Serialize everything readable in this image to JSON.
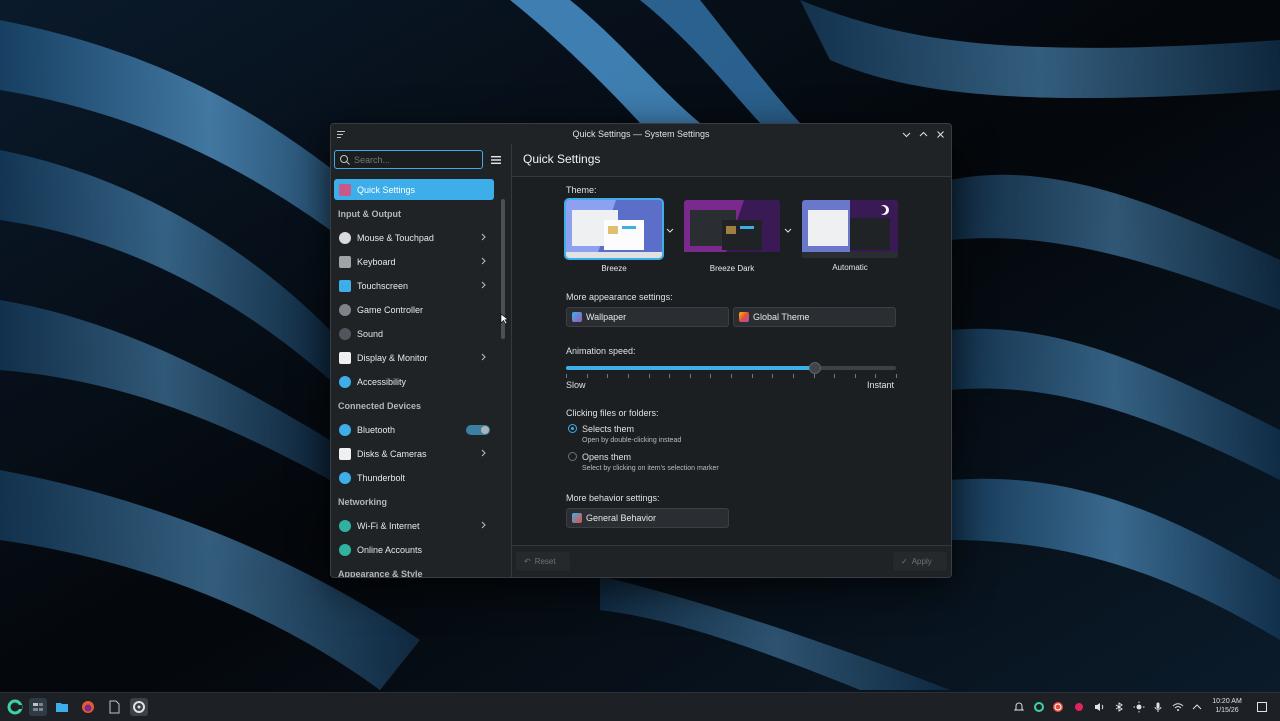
{
  "window": {
    "title": "Quick Settings — System Settings"
  },
  "sidebar": {
    "search_placeholder": "Search...",
    "items": [
      {
        "type": "item",
        "label": "Quick Settings",
        "icon": "quick-settings-icon",
        "active": true
      },
      {
        "type": "category",
        "label": "Input & Output"
      },
      {
        "type": "item",
        "label": "Mouse & Touchpad",
        "icon": "mouse-icon",
        "chevron": true
      },
      {
        "type": "item",
        "label": "Keyboard",
        "icon": "keyboard-icon",
        "chevron": true
      },
      {
        "type": "item",
        "label": "Touchscreen",
        "icon": "touchscreen-icon",
        "chevron": true
      },
      {
        "type": "item",
        "label": "Game Controller",
        "icon": "gamepad-icon"
      },
      {
        "type": "item",
        "label": "Sound",
        "icon": "speaker-icon"
      },
      {
        "type": "item",
        "label": "Display & Monitor",
        "icon": "monitor-icon",
        "chevron": true
      },
      {
        "type": "item",
        "label": "Accessibility",
        "icon": "accessibility-icon"
      },
      {
        "type": "category",
        "label": "Connected Devices"
      },
      {
        "type": "item",
        "label": "Bluetooth",
        "icon": "bluetooth-icon",
        "toggle": true
      },
      {
        "type": "item",
        "label": "Disks & Cameras",
        "icon": "disk-icon",
        "chevron": true
      },
      {
        "type": "item",
        "label": "Thunderbolt",
        "icon": "thunderbolt-icon"
      },
      {
        "type": "category",
        "label": "Networking"
      },
      {
        "type": "item",
        "label": "Wi-Fi & Internet",
        "icon": "wifi-globe-icon",
        "chevron": true
      },
      {
        "type": "item",
        "label": "Online Accounts",
        "icon": "online-accounts-icon"
      },
      {
        "type": "category",
        "label": "Appearance & Style"
      }
    ]
  },
  "main": {
    "title": "Quick Settings",
    "theme_label": "Theme:",
    "themes": [
      {
        "name": "Breeze",
        "selected": true
      },
      {
        "name": "Breeze Dark",
        "selected": false
      },
      {
        "name": "Automatic",
        "selected": false
      }
    ],
    "appearance_label": "More appearance settings:",
    "wallpaper_button": "Wallpaper",
    "global_theme_button": "Global Theme",
    "animation_label": "Animation speed:",
    "animation_speed_fraction": 0.75,
    "slow_label": "Slow",
    "instant_label": "Instant",
    "clicking_label": "Clicking files or folders:",
    "option_select": "Selects them",
    "option_select_hint": "Open by double-clicking instead",
    "option_open": "Opens them",
    "option_open_hint": "Select by clicking on item's selection marker",
    "behavior_label": "More behavior settings:",
    "general_behavior_button": "General Behavior",
    "reset_button": "Reset",
    "apply_button": "Apply"
  },
  "taskbar": {
    "time": "10:20 AM",
    "date": "1/15/26"
  },
  "colors": {
    "accent": "#3daee9",
    "window_bg": "#202326",
    "content_bg": "#1c1f22"
  }
}
